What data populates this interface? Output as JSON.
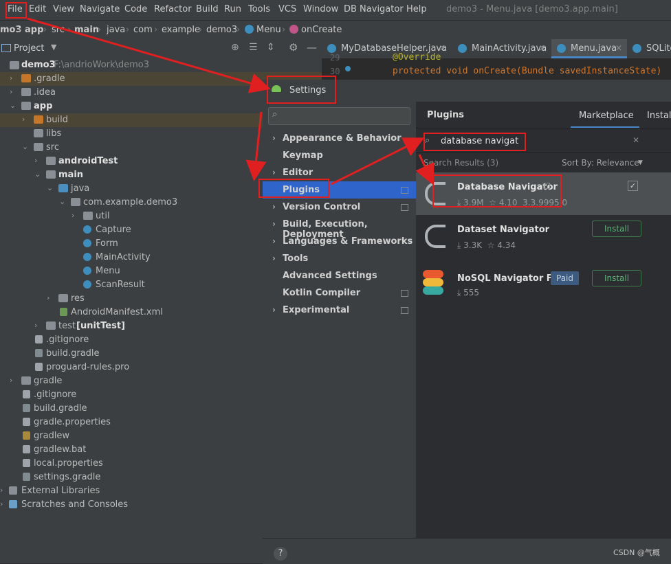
{
  "menu": {
    "items": [
      "File",
      "Edit",
      "View",
      "Navigate",
      "Code",
      "Refactor",
      "Build",
      "Run",
      "Tools",
      "VCS",
      "Window",
      "DB Navigator",
      "Help"
    ],
    "title": "demo3 - Menu.java [demo3.app.main]"
  },
  "breadcrumb": {
    "items": [
      "mo3",
      "app",
      "src",
      "main",
      "java",
      "com",
      "example",
      "demo3",
      "Menu",
      "onCreate"
    ]
  },
  "project": {
    "header": "Project",
    "rows": [
      {
        "label": "demo3",
        "extra": "F:\\andrioWork\\demo3"
      },
      {
        "label": ".gradle"
      },
      {
        "label": ".idea"
      },
      {
        "label": "app"
      },
      {
        "label": "build"
      },
      {
        "label": "libs"
      },
      {
        "label": "src"
      },
      {
        "label": "androidTest"
      },
      {
        "label": "main"
      },
      {
        "label": "java"
      },
      {
        "label": "com.example.demo3"
      },
      {
        "label": "util"
      },
      {
        "label": "Capture"
      },
      {
        "label": "Form"
      },
      {
        "label": "MainActivity"
      },
      {
        "label": "Menu"
      },
      {
        "label": "ScanResult"
      },
      {
        "label": "res"
      },
      {
        "label": "AndroidManifest.xml"
      },
      {
        "label": "test",
        "extra": "[unitTest]"
      },
      {
        "label": ".gitignore"
      },
      {
        "label": "build.gradle"
      },
      {
        "label": "proguard-rules.pro"
      },
      {
        "label": "gradle"
      },
      {
        "label": ".gitignore"
      },
      {
        "label": "build.gradle"
      },
      {
        "label": "gradle.properties"
      },
      {
        "label": "gradlew"
      },
      {
        "label": "gradlew.bat"
      },
      {
        "label": "local.properties"
      },
      {
        "label": "settings.gradle"
      },
      {
        "label": "External Libraries"
      },
      {
        "label": "Scratches and Consoles"
      }
    ]
  },
  "editor": {
    "tabs": [
      "MyDatabaseHelper.java",
      "MainActivity.java",
      "Menu.java",
      "SQLite"
    ],
    "line_numbers": [
      "29",
      "30"
    ],
    "lines": [
      "@Override",
      "protected void onCreate(Bundle savedInstanceState)"
    ]
  },
  "settings": {
    "title": "Settings",
    "search_placeholder": "",
    "sidebar": [
      "Appearance & Behavior",
      "Keymap",
      "Editor",
      "Plugins",
      "Version Control",
      "Build, Execution, Deployment",
      "Languages & Frameworks",
      "Tools",
      "Advanced Settings",
      "Kotlin Compiler",
      "Experimental"
    ],
    "plugins_title": "Plugins",
    "tabs": [
      "Marketplace",
      "Installed"
    ],
    "search_value": "database navigat",
    "results_label": "Search Results (3)",
    "sort_label": "Sort By: Relevance",
    "results": [
      {
        "name": "Database Navigator",
        "downloads": "3.9M",
        "rating": "4.10",
        "version": "3.3.9995.0"
      },
      {
        "name": "Dataset Navigator",
        "downloads": "3.3K",
        "rating": "4.34",
        "button": "Install"
      },
      {
        "name": "NoSQL Navigator F...",
        "downloads": "555",
        "badge": "Paid",
        "button": "Install"
      }
    ],
    "help": "?",
    "watermark": "CSDN @气概"
  }
}
